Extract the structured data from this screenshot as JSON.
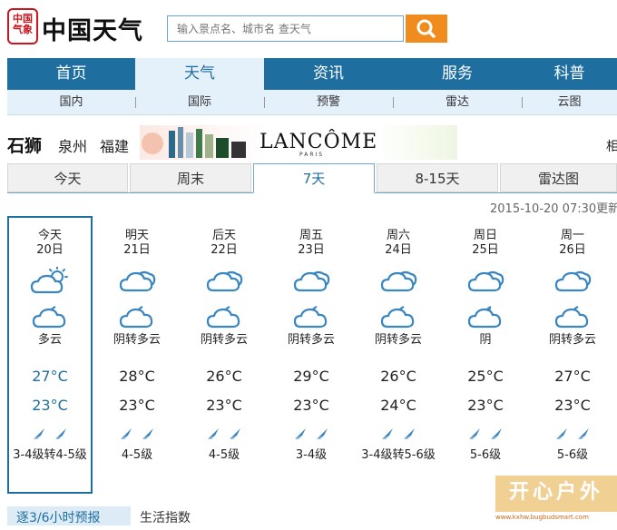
{
  "header": {
    "logo_seal": "中国气象",
    "logo_text": "中国天气",
    "search_placeholder": "输入景点名、城市名 查天气",
    "search_icon": "search-icon"
  },
  "nav": [
    "首页",
    "天气",
    "资讯",
    "服务",
    "科普"
  ],
  "subnav": [
    "国内",
    "国际",
    "预警",
    "雷达",
    "云图"
  ],
  "location": {
    "city": "石狮",
    "links": [
      "泉州",
      "福建"
    ],
    "right_text": "相"
  },
  "ad": {
    "brand": "LANCÔME",
    "sub": "PARIS"
  },
  "tabs": [
    "今天",
    "周末",
    "7天",
    "8-15天",
    "雷达图"
  ],
  "active_tab": "7天",
  "update_time": "2015-10-20 07:30更新",
  "days": [
    {
      "name": "今天",
      "date": "20日",
      "day_icon": "partly-sunny-icon",
      "night_icon": "cloudy-night-icon",
      "weather": "多云",
      "high": "27°C",
      "low": "23°C",
      "wind": "3-4级转4-5级"
    },
    {
      "name": "明天",
      "date": "21日",
      "day_icon": "cloud-icon",
      "night_icon": "cloudy-night-icon",
      "weather": "阴转多云",
      "high": "28°C",
      "low": "23°C",
      "wind": "4-5级"
    },
    {
      "name": "后天",
      "date": "22日",
      "day_icon": "cloud-icon",
      "night_icon": "cloudy-night-icon",
      "weather": "阴转多云",
      "high": "26°C",
      "low": "23°C",
      "wind": "4-5级"
    },
    {
      "name": "周五",
      "date": "23日",
      "day_icon": "cloud-icon",
      "night_icon": "cloudy-night-icon",
      "weather": "阴转多云",
      "high": "29°C",
      "low": "23°C",
      "wind": "3-4级"
    },
    {
      "name": "周六",
      "date": "24日",
      "day_icon": "cloud-icon",
      "night_icon": "cloudy-night-icon",
      "weather": "阴转多云",
      "high": "26°C",
      "low": "24°C",
      "wind": "3-4级转5-6级"
    },
    {
      "name": "周日",
      "date": "25日",
      "day_icon": "cloud-icon",
      "night_icon": "overcast-night-icon",
      "weather": "阴",
      "high": "25°C",
      "low": "23°C",
      "wind": "5-6级"
    },
    {
      "name": "周一",
      "date": "26日",
      "day_icon": "cloud-icon",
      "night_icon": "cloudy-night-icon",
      "weather": "阴转多云",
      "high": "27°C",
      "low": "23°C",
      "wind": "5-6级"
    }
  ],
  "bottom": {
    "tab1": "逐3/6小时预报",
    "tab2": "生活指数"
  },
  "watermark": {
    "text": "开心户外",
    "sub": "www.kxhw.bugbudsmart.com"
  },
  "colors": {
    "primary": "#1f6ea0",
    "light": "#e4f1fb",
    "accent": "#f08c1e",
    "icon_blue": "#3a86c0"
  }
}
